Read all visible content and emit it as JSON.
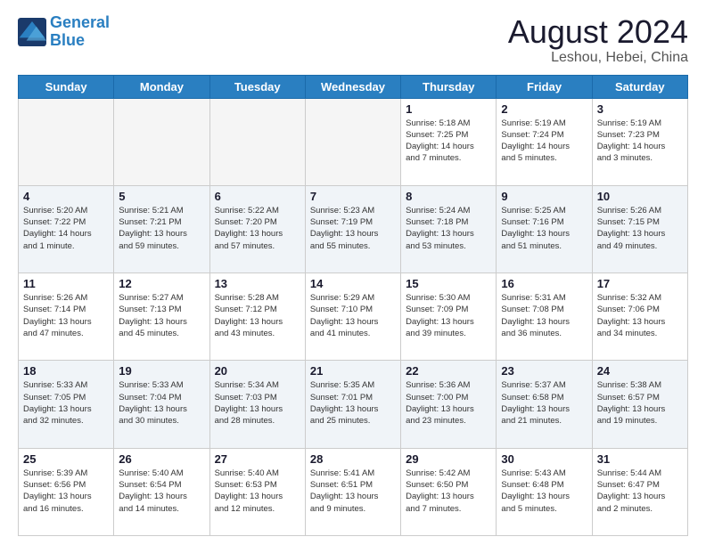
{
  "logo": {
    "line1": "General",
    "line2": "Blue"
  },
  "title": "August 2024",
  "subtitle": "Leshou, Hebei, China",
  "weekdays": [
    "Sunday",
    "Monday",
    "Tuesday",
    "Wednesday",
    "Thursday",
    "Friday",
    "Saturday"
  ],
  "weeks": [
    [
      {
        "day": "",
        "info": ""
      },
      {
        "day": "",
        "info": ""
      },
      {
        "day": "",
        "info": ""
      },
      {
        "day": "",
        "info": ""
      },
      {
        "day": "1",
        "info": "Sunrise: 5:18 AM\nSunset: 7:25 PM\nDaylight: 14 hours\nand 7 minutes."
      },
      {
        "day": "2",
        "info": "Sunrise: 5:19 AM\nSunset: 7:24 PM\nDaylight: 14 hours\nand 5 minutes."
      },
      {
        "day": "3",
        "info": "Sunrise: 5:19 AM\nSunset: 7:23 PM\nDaylight: 14 hours\nand 3 minutes."
      }
    ],
    [
      {
        "day": "4",
        "info": "Sunrise: 5:20 AM\nSunset: 7:22 PM\nDaylight: 14 hours\nand 1 minute."
      },
      {
        "day": "5",
        "info": "Sunrise: 5:21 AM\nSunset: 7:21 PM\nDaylight: 13 hours\nand 59 minutes."
      },
      {
        "day": "6",
        "info": "Sunrise: 5:22 AM\nSunset: 7:20 PM\nDaylight: 13 hours\nand 57 minutes."
      },
      {
        "day": "7",
        "info": "Sunrise: 5:23 AM\nSunset: 7:19 PM\nDaylight: 13 hours\nand 55 minutes."
      },
      {
        "day": "8",
        "info": "Sunrise: 5:24 AM\nSunset: 7:18 PM\nDaylight: 13 hours\nand 53 minutes."
      },
      {
        "day": "9",
        "info": "Sunrise: 5:25 AM\nSunset: 7:16 PM\nDaylight: 13 hours\nand 51 minutes."
      },
      {
        "day": "10",
        "info": "Sunrise: 5:26 AM\nSunset: 7:15 PM\nDaylight: 13 hours\nand 49 minutes."
      }
    ],
    [
      {
        "day": "11",
        "info": "Sunrise: 5:26 AM\nSunset: 7:14 PM\nDaylight: 13 hours\nand 47 minutes."
      },
      {
        "day": "12",
        "info": "Sunrise: 5:27 AM\nSunset: 7:13 PM\nDaylight: 13 hours\nand 45 minutes."
      },
      {
        "day": "13",
        "info": "Sunrise: 5:28 AM\nSunset: 7:12 PM\nDaylight: 13 hours\nand 43 minutes."
      },
      {
        "day": "14",
        "info": "Sunrise: 5:29 AM\nSunset: 7:10 PM\nDaylight: 13 hours\nand 41 minutes."
      },
      {
        "day": "15",
        "info": "Sunrise: 5:30 AM\nSunset: 7:09 PM\nDaylight: 13 hours\nand 39 minutes."
      },
      {
        "day": "16",
        "info": "Sunrise: 5:31 AM\nSunset: 7:08 PM\nDaylight: 13 hours\nand 36 minutes."
      },
      {
        "day": "17",
        "info": "Sunrise: 5:32 AM\nSunset: 7:06 PM\nDaylight: 13 hours\nand 34 minutes."
      }
    ],
    [
      {
        "day": "18",
        "info": "Sunrise: 5:33 AM\nSunset: 7:05 PM\nDaylight: 13 hours\nand 32 minutes."
      },
      {
        "day": "19",
        "info": "Sunrise: 5:33 AM\nSunset: 7:04 PM\nDaylight: 13 hours\nand 30 minutes."
      },
      {
        "day": "20",
        "info": "Sunrise: 5:34 AM\nSunset: 7:03 PM\nDaylight: 13 hours\nand 28 minutes."
      },
      {
        "day": "21",
        "info": "Sunrise: 5:35 AM\nSunset: 7:01 PM\nDaylight: 13 hours\nand 25 minutes."
      },
      {
        "day": "22",
        "info": "Sunrise: 5:36 AM\nSunset: 7:00 PM\nDaylight: 13 hours\nand 23 minutes."
      },
      {
        "day": "23",
        "info": "Sunrise: 5:37 AM\nSunset: 6:58 PM\nDaylight: 13 hours\nand 21 minutes."
      },
      {
        "day": "24",
        "info": "Sunrise: 5:38 AM\nSunset: 6:57 PM\nDaylight: 13 hours\nand 19 minutes."
      }
    ],
    [
      {
        "day": "25",
        "info": "Sunrise: 5:39 AM\nSunset: 6:56 PM\nDaylight: 13 hours\nand 16 minutes."
      },
      {
        "day": "26",
        "info": "Sunrise: 5:40 AM\nSunset: 6:54 PM\nDaylight: 13 hours\nand 14 minutes."
      },
      {
        "day": "27",
        "info": "Sunrise: 5:40 AM\nSunset: 6:53 PM\nDaylight: 13 hours\nand 12 minutes."
      },
      {
        "day": "28",
        "info": "Sunrise: 5:41 AM\nSunset: 6:51 PM\nDaylight: 13 hours\nand 9 minutes."
      },
      {
        "day": "29",
        "info": "Sunrise: 5:42 AM\nSunset: 6:50 PM\nDaylight: 13 hours\nand 7 minutes."
      },
      {
        "day": "30",
        "info": "Sunrise: 5:43 AM\nSunset: 6:48 PM\nDaylight: 13 hours\nand 5 minutes."
      },
      {
        "day": "31",
        "info": "Sunrise: 5:44 AM\nSunset: 6:47 PM\nDaylight: 13 hours\nand 2 minutes."
      }
    ]
  ]
}
